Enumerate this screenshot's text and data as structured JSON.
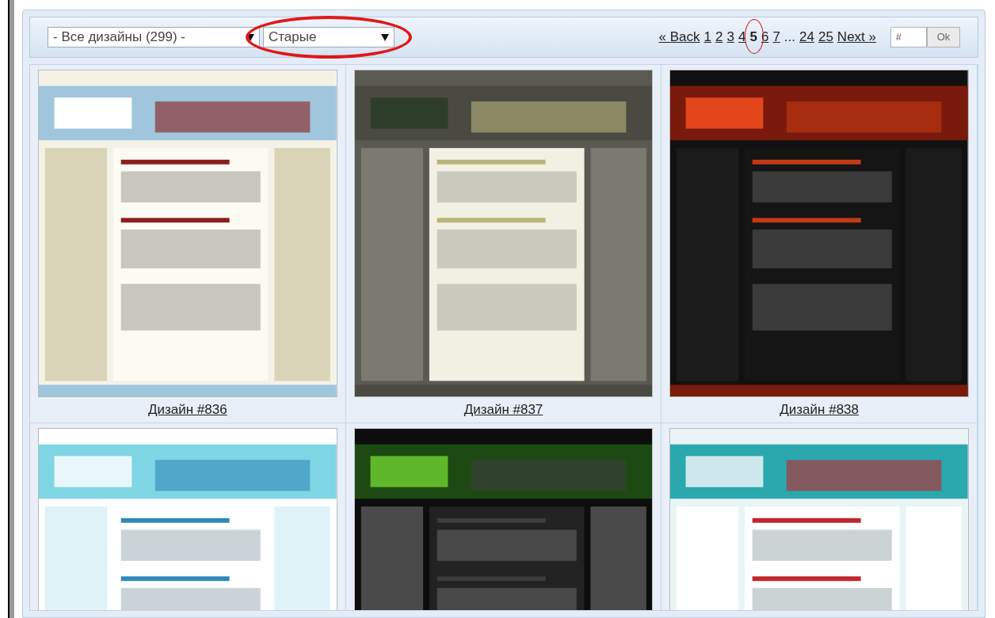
{
  "filters": [
    {
      "value": "- Все дизайны (299) -",
      "highlighted": false
    },
    {
      "value": "Старые",
      "highlighted": true
    }
  ],
  "pagination": {
    "back": "« Back",
    "next": "Next »",
    "pages": [
      {
        "kind": "link",
        "label": "1",
        "selected": false
      },
      {
        "kind": "link",
        "label": "2",
        "selected": false
      },
      {
        "kind": "link",
        "label": "3",
        "selected": false
      },
      {
        "kind": "link",
        "label": "4",
        "selected": false
      },
      {
        "kind": "link",
        "label": "5",
        "selected": true
      },
      {
        "kind": "link",
        "label": "6",
        "selected": false
      },
      {
        "kind": "link",
        "label": "7",
        "selected": false
      },
      {
        "kind": "gap",
        "label": "..."
      },
      {
        "kind": "link",
        "label": "24",
        "selected": false
      },
      {
        "kind": "link",
        "label": "25",
        "selected": false
      }
    ],
    "page_field": {
      "placeholder": "#"
    },
    "go_button": "Ok"
  },
  "designs": [
    {
      "kind": "picture",
      "caption": "Дизайн #836"
    },
    {
      "kind": "picture",
      "caption": "Дизайн #837"
    },
    {
      "kind": "picture",
      "caption": "Дизайн #838"
    },
    {
      "kind": "picture"
    },
    {
      "kind": "picture"
    },
    {
      "kind": "picture"
    }
  ]
}
